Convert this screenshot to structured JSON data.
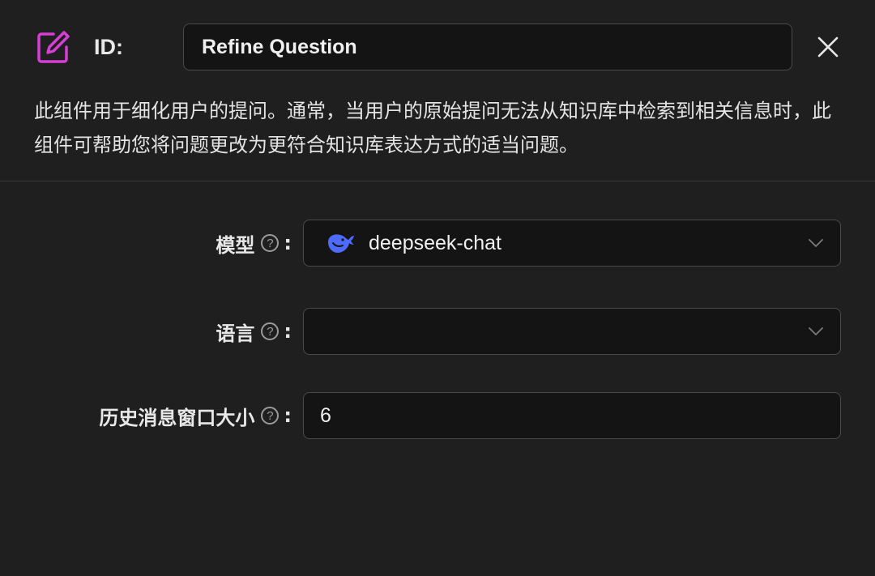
{
  "header": {
    "id_label": "ID:",
    "id_value": "Refine Question",
    "description": "此组件用于细化用户的提问。通常，当用户的原始提问无法从知识库中检索到相关信息时，此组件可帮助您将问题更改为更符合知识库表达方式的适当问题。"
  },
  "form": {
    "model": {
      "label": "模型",
      "value": "deepseek-chat",
      "icon": "deepseek-whale-icon"
    },
    "language": {
      "label": "语言",
      "value": ""
    },
    "history_window": {
      "label": "历史消息窗口大小",
      "value": "6"
    },
    "colon": ":"
  },
  "colors": {
    "background": "#1f1f1f",
    "input_background": "#141414",
    "border": "#4a4a4a",
    "accent_icon": "#d63fd6",
    "model_logo": "#4d6bfe"
  }
}
